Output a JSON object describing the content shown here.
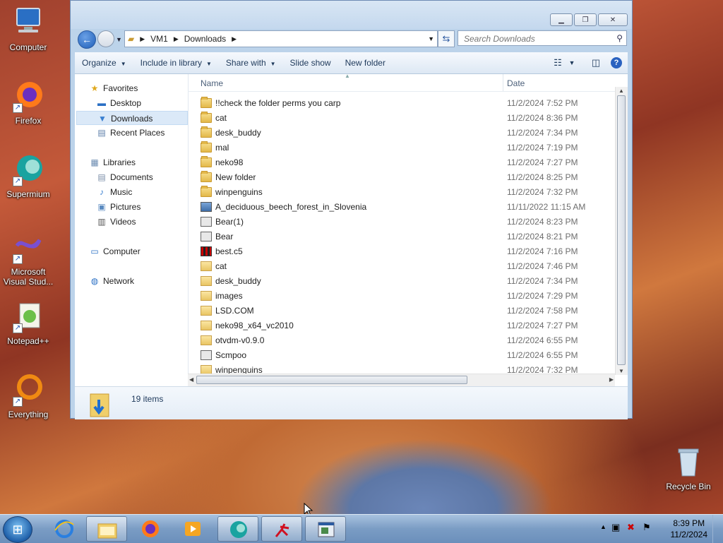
{
  "desktop": {
    "icons": [
      {
        "label": "Computer",
        "icon": "computer-icon"
      },
      {
        "label": "Firefox",
        "icon": "firefox-icon"
      },
      {
        "label": "Supermium",
        "icon": "supermium-icon"
      },
      {
        "label": "Microsoft Visual Stud...",
        "icon": "visual-studio-icon"
      },
      {
        "label": "Notepad++",
        "icon": "notepad-plus-plus-icon"
      },
      {
        "label": "Everything",
        "icon": "everything-icon"
      },
      {
        "label": "Recycle Bin",
        "icon": "recycle-bin-icon"
      }
    ]
  },
  "window": {
    "address": {
      "segments": [
        "VM1",
        "Downloads"
      ]
    },
    "search": {
      "placeholder": "Search Downloads"
    },
    "toolbar": {
      "organize": "Organize",
      "include_in_library": "Include in library",
      "share_with": "Share with",
      "slide_show": "Slide show",
      "new_folder": "New folder"
    },
    "nav": {
      "favorites": "Favorites",
      "desktop": "Desktop",
      "downloads": "Downloads",
      "recent_places": "Recent Places",
      "libraries": "Libraries",
      "documents": "Documents",
      "music": "Music",
      "pictures": "Pictures",
      "videos": "Videos",
      "computer": "Computer",
      "network": "Network"
    },
    "columns": {
      "name": "Name",
      "date": "Date"
    },
    "files": [
      {
        "name": "!!check the folder perms you carp",
        "date": "11/2/2024 7:52 PM",
        "type": "folder"
      },
      {
        "name": "cat",
        "date": "11/2/2024 8:36 PM",
        "type": "folder"
      },
      {
        "name": "desk_buddy",
        "date": "11/2/2024 7:34 PM",
        "type": "folder"
      },
      {
        "name": "mal",
        "date": "11/2/2024 7:19 PM",
        "type": "folder"
      },
      {
        "name": "neko98",
        "date": "11/2/2024 7:27 PM",
        "type": "folder"
      },
      {
        "name": "New folder",
        "date": "11/2/2024 8:25 PM",
        "type": "folder"
      },
      {
        "name": "winpenguins",
        "date": "11/2/2024 7:32 PM",
        "type": "folder"
      },
      {
        "name": "A_deciduous_beech_forest_in_Slovenia",
        "date": "11/11/2022 11:15 AM",
        "type": "image"
      },
      {
        "name": "Bear(1)",
        "date": "11/2/2024 8:23 PM",
        "type": "app"
      },
      {
        "name": "Bear",
        "date": "11/2/2024 8:21 PM",
        "type": "app"
      },
      {
        "name": "best.c5",
        "date": "11/2/2024 7:16 PM",
        "type": "batch"
      },
      {
        "name": "cat",
        "date": "11/2/2024 7:46 PM",
        "type": "zip"
      },
      {
        "name": "desk_buddy",
        "date": "11/2/2024 7:34 PM",
        "type": "zip"
      },
      {
        "name": "images",
        "date": "11/2/2024 7:29 PM",
        "type": "zip"
      },
      {
        "name": "LSD.COM",
        "date": "11/2/2024 7:58 PM",
        "type": "zip"
      },
      {
        "name": "neko98_x64_vc2010",
        "date": "11/2/2024 7:27 PM",
        "type": "zip"
      },
      {
        "name": "otvdm-v0.9.0",
        "date": "11/2/2024 6:55 PM",
        "type": "zip"
      },
      {
        "name": "Scmpoo",
        "date": "11/2/2024 6:55 PM",
        "type": "app"
      },
      {
        "name": "winpenguins",
        "date": "11/2/2024 7:32 PM",
        "type": "zip"
      }
    ],
    "status": {
      "count": "19 items"
    }
  },
  "taskbar": {
    "clock": {
      "time": "8:39 PM",
      "date": "11/2/2024"
    }
  }
}
